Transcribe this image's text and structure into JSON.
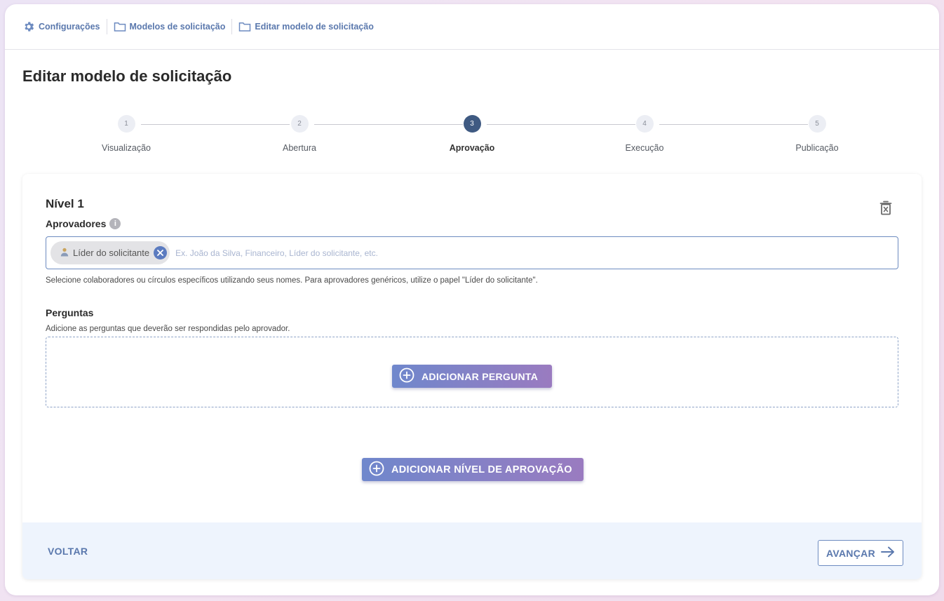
{
  "breadcrumb": [
    {
      "label": "Configurações",
      "icon": "gear-icon"
    },
    {
      "label": "Modelos de solicitação",
      "icon": "folder-icon"
    },
    {
      "label": "Editar modelo de solicitação",
      "icon": "folder-icon"
    }
  ],
  "page_title": "Editar modelo de solicitação",
  "stepper": {
    "active_step": 3,
    "steps": [
      {
        "number": "1",
        "label": "Visualização"
      },
      {
        "number": "2",
        "label": "Abertura"
      },
      {
        "number": "3",
        "label": "Aprovação"
      },
      {
        "number": "4",
        "label": "Execução"
      },
      {
        "number": "5",
        "label": "Publicação"
      }
    ]
  },
  "level": {
    "title": "Nível 1",
    "approvers_label": "Aprovadores",
    "approvers_chip": "Líder do solicitante",
    "approvers_placeholder": "Ex. João da Silva, Financeiro, Líder do solicitante, etc.",
    "approvers_helper": "Selecione colaboradores ou círculos específicos utilizando seus nomes. Para aprovadores genéricos, utilize o papel \"Líder do solicitante\".",
    "questions_label": "Perguntas",
    "questions_hint": "Adicione as perguntas que deverão ser respondidas pelo aprovador.",
    "add_question_label": "ADICIONAR PERGUNTA"
  },
  "add_level_label": "ADICIONAR NÍVEL DE APROVAÇÃO",
  "footer": {
    "back_label": "VOLTAR",
    "next_label": "AVANÇAR"
  },
  "colors": {
    "accent": "#5a78ad",
    "active_step": "#3f5a82",
    "button_gradient_start": "#6f87cc",
    "button_gradient_end": "#9a7bc0"
  }
}
